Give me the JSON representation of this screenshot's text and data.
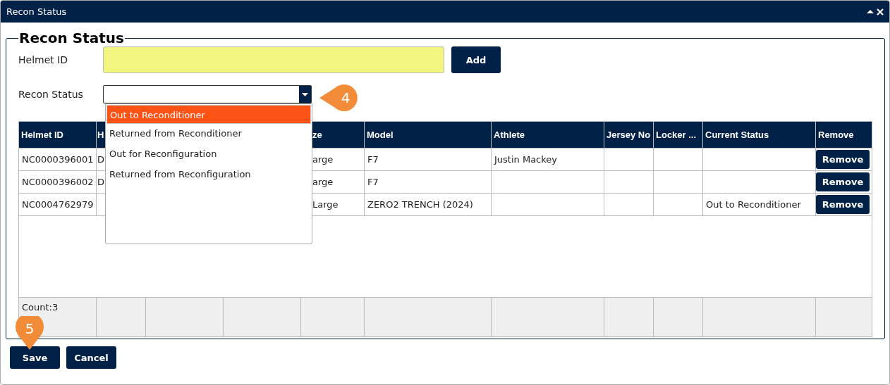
{
  "window": {
    "title": "Recon Status"
  },
  "form": {
    "legend": "Recon Status",
    "helmet_id": {
      "label": "Helmet ID",
      "add_button": "Add"
    },
    "recon_status": {
      "label": "Recon Status",
      "expanded": true,
      "options": [
        {
          "label": "Out to Reconditioner",
          "selected": true
        },
        {
          "label": "Returned from Reconditioner",
          "selected": false
        },
        {
          "label": "Out for Reconfiguration",
          "selected": false
        },
        {
          "label": "Returned from Reconfiguration",
          "selected": false
        }
      ]
    }
  },
  "table": {
    "columns": [
      {
        "label": "Helmet ID"
      },
      {
        "label": "H"
      },
      {},
      {},
      {
        "label": "ze"
      },
      {
        "label": "Model"
      },
      {
        "label": "Athlete"
      },
      {
        "label": "Jersey No"
      },
      {
        "label": "Locker ..."
      },
      {
        "label": "Current Status"
      },
      {
        "label": "Remove"
      }
    ],
    "rows": [
      {
        "helmet_id": "NC0000396001",
        "column_2": "D",
        "column_5": "arge",
        "model": "F7",
        "athlete": "Justin Mackey",
        "remove_button": "Remove"
      },
      {
        "helmet_id": "NC0000396002",
        "column_2": "D",
        "column_5": "arge",
        "model": "F7",
        "remove_button": "Remove"
      },
      {
        "helmet_id": "NC0004762979",
        "column_5": "Large",
        "model": "ZERO2 TRENCH (2024)",
        "current_status": "Out to Reconditioner",
        "remove_button": "Remove"
      }
    ],
    "footer": "Count:3"
  },
  "buttons": [
    "Save",
    "Cancel"
  ],
  "callouts": [
    "4",
    "5"
  ]
}
